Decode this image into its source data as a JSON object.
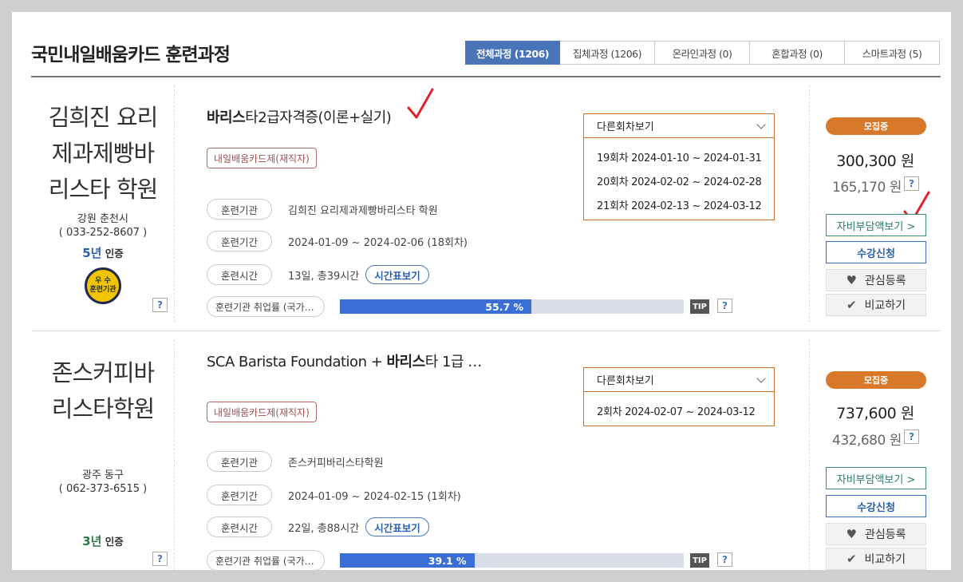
{
  "page_title": "국민내일배움카드 훈련과정",
  "tabs": [
    {
      "label": "전체과정 (1206)",
      "active": true
    },
    {
      "label": "집체과정 (1206)",
      "active": false
    },
    {
      "label": "온라인과정 (0)",
      "active": false
    },
    {
      "label": "혼합과정 (0)",
      "active": false
    },
    {
      "label": "스마트과정 (5)",
      "active": false
    }
  ],
  "labels": {
    "institution": "훈련기관",
    "period": "훈련기간",
    "time": "훈련시간",
    "time_table": "시간표보기",
    "employment": "훈련기관 취업률 (국가…",
    "tip": "TIP",
    "help": "?",
    "other_rounds": "다른회차보기",
    "self_pay": "자비부담액보기 >",
    "apply": "수강신청",
    "like": "관심등록",
    "compare": "비교하기"
  },
  "courses": [
    {
      "inst_name": [
        "김희진 요리",
        "제과제빵바",
        "리스타 학원"
      ],
      "location": "강원 춘천시",
      "phone": "( 033-252-8607 )",
      "cert_years": "5년",
      "cert_label": "인증",
      "badge_top": "우 수",
      "badge_bottom": "훈련기관",
      "title_bold": "바리스",
      "title_rest": "타2급자격증(이론+실기)",
      "tag": "내일배움카드제(재직자)",
      "institution": "김희진 요리제과제빵바리스타 학원",
      "period": "2024-01-09 ~ 2024-02-06 (18회차)",
      "time": "13일, 총39시간",
      "employment_rate": 55.7,
      "employment_text": "55.7 %",
      "rounds": [
        "19회차 2024-01-10 ~ 2024-01-31",
        "20회차 2024-02-02 ~ 2024-02-28",
        "21회차 2024-02-13 ~ 2024-03-12"
      ],
      "status": "모집중",
      "price": "300,300 원",
      "self_price": "165,170 원"
    },
    {
      "inst_name": [
        "존스커피바",
        "리스타학원"
      ],
      "location": "광주 동구",
      "phone": "( 062-373-6515 )",
      "cert_years": "3년",
      "cert_label": "인증",
      "title_pre": "SCA Barista Foundation + ",
      "title_bold": "바리스",
      "title_rest": "타 1급 …",
      "tag": "내일배움카드제(재직자)",
      "institution": "존스커피바리스타학원",
      "period": "2024-01-09 ~ 2024-02-15 (1회차)",
      "time": "22일, 총88시간",
      "employment_rate": 39.1,
      "employment_text": "39.1 %",
      "rounds": [
        "2회차 2024-02-07 ~ 2024-03-12"
      ],
      "status": "모집중",
      "price": "737,600 원",
      "self_price": "432,680 원"
    }
  ],
  "colors": {
    "accent": "#4a74b8",
    "status": "#d8792a",
    "bar_fill": "#3b6fd6",
    "check": "#e0222a"
  }
}
